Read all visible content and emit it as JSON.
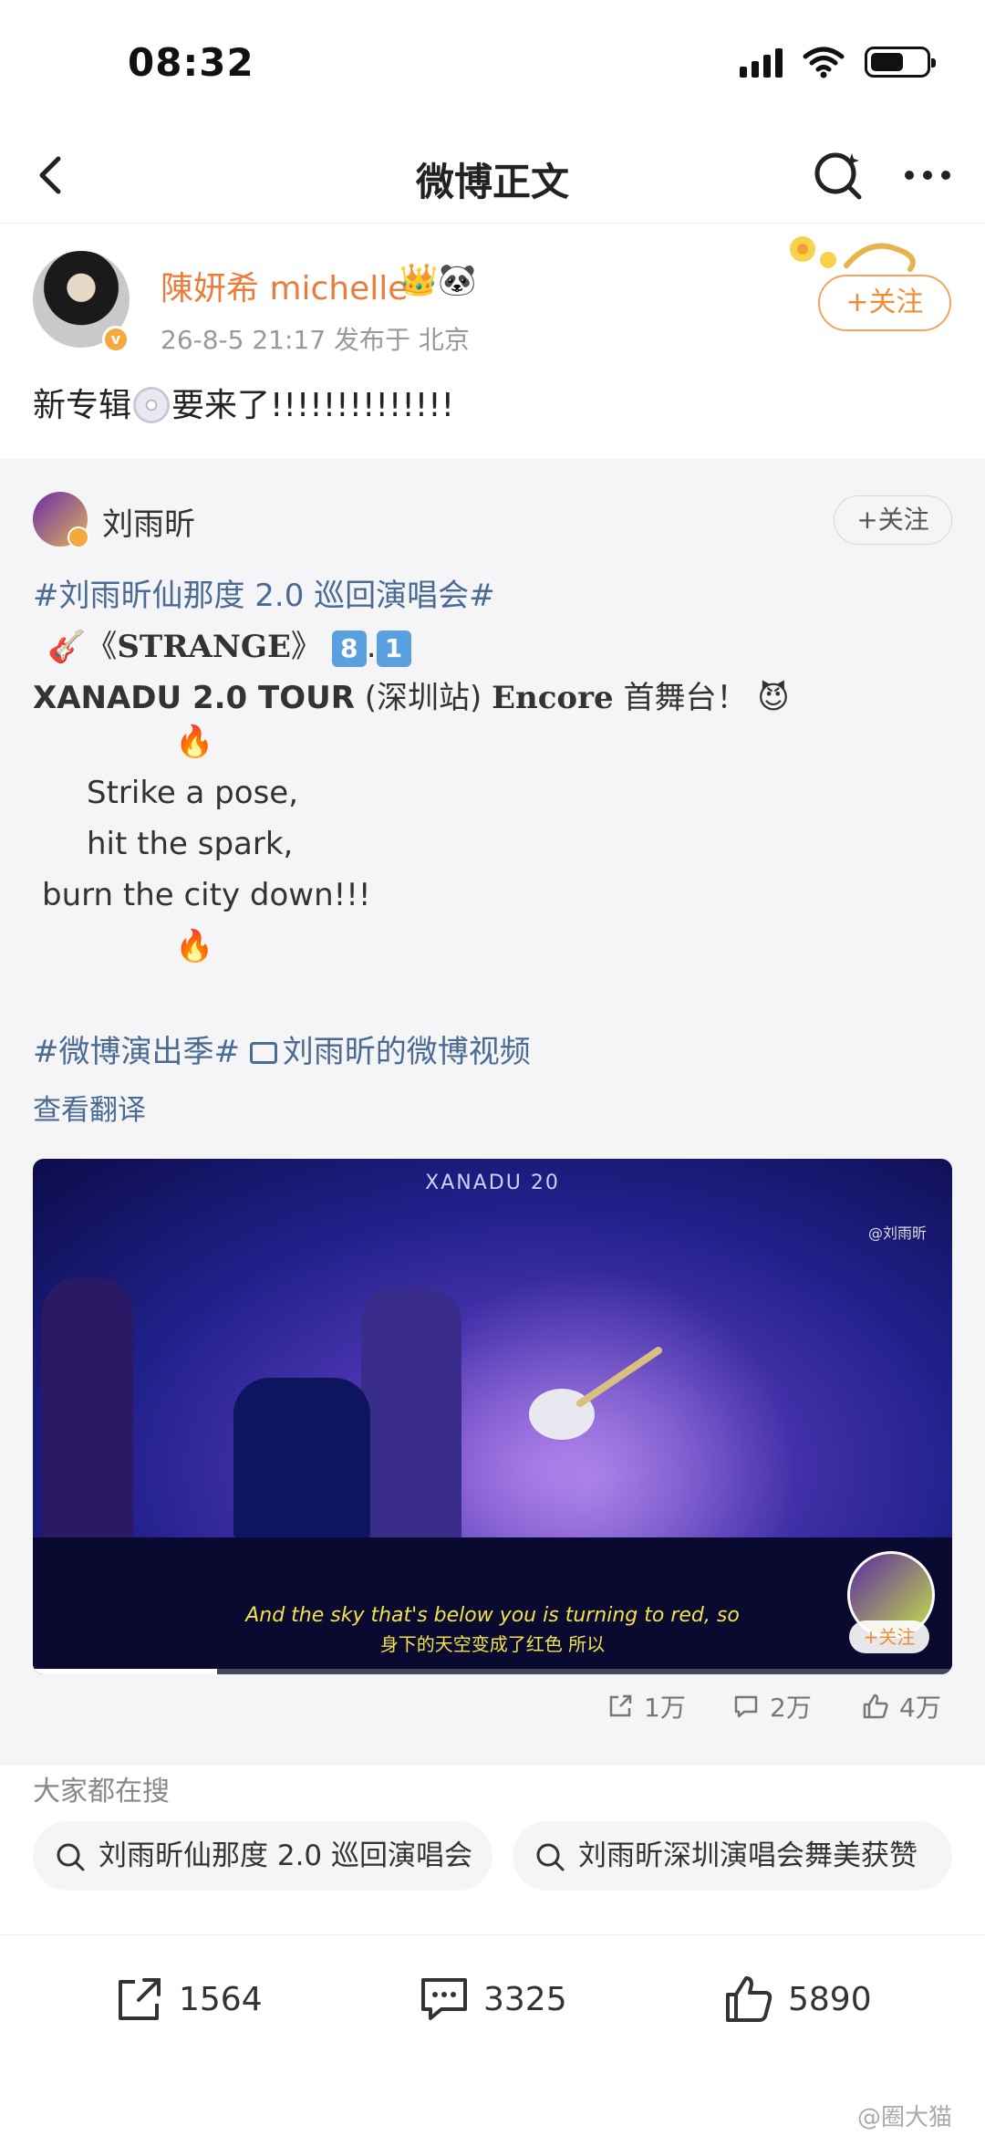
{
  "status_bar": {
    "time": "08:32"
  },
  "nav": {
    "title": "微博正文"
  },
  "post": {
    "username": "陳妍希 michelle",
    "username_deco": "👑🐼",
    "badge": "v",
    "meta": "26-8-5 21:17  发布于 北京",
    "follow_label": "+关注",
    "text_before": "新专辑",
    "text_after": "要来了!!!!!!!!!!!!!!"
  },
  "repost": {
    "username": "刘雨昕",
    "follow_label": "+关注",
    "topic1": "#刘雨昕仙那度 2.0 巡回演唱会#",
    "line2_a": "🎸《",
    "line2_title": "STRANGE",
    "line2_b": "》",
    "line2_k1": "8",
    "line2_dot": ".",
    "line2_k2": "1",
    "line3_a": "XANADU 2.0 TOUR",
    "line3_b": "(深圳站)",
    "line3_c": "Encore",
    "line3_d": "首舞台！",
    "line3_emoji": "😈",
    "fire1": "🔥",
    "lyric1": "Strike a pose,",
    "lyric2": "hit the spark,",
    "lyric3": "burn the city down!!!",
    "fire2": "🔥",
    "topic2": "#微博演出季#",
    "video_link": "刘雨昕的微博视频",
    "translate": "查看翻译",
    "video": {
      "logo": "XANADU 20",
      "watermark": "@刘雨昕",
      "subtitle_en": "And the sky that's below you is turning to red, so",
      "subtitle_zh": "身下的天空变成了红色 所以",
      "follow_label": "+关注",
      "progress": 0.2
    },
    "stats": {
      "reposts": "1万",
      "comments": "2万",
      "likes": "4万"
    }
  },
  "search": {
    "title": "大家都在搜",
    "chips": [
      "刘雨昕仙那度 2.0 巡回演唱会",
      "刘雨昕深圳演唱会舞美获赞"
    ]
  },
  "actions": {
    "reposts": "1564",
    "comments": "3325",
    "likes": "5890"
  },
  "watermark": "@圈大猫",
  "colors": {
    "accent": "#eb7d3c",
    "topic": "#4a6b93",
    "card_bg": "#f5f5f7"
  }
}
